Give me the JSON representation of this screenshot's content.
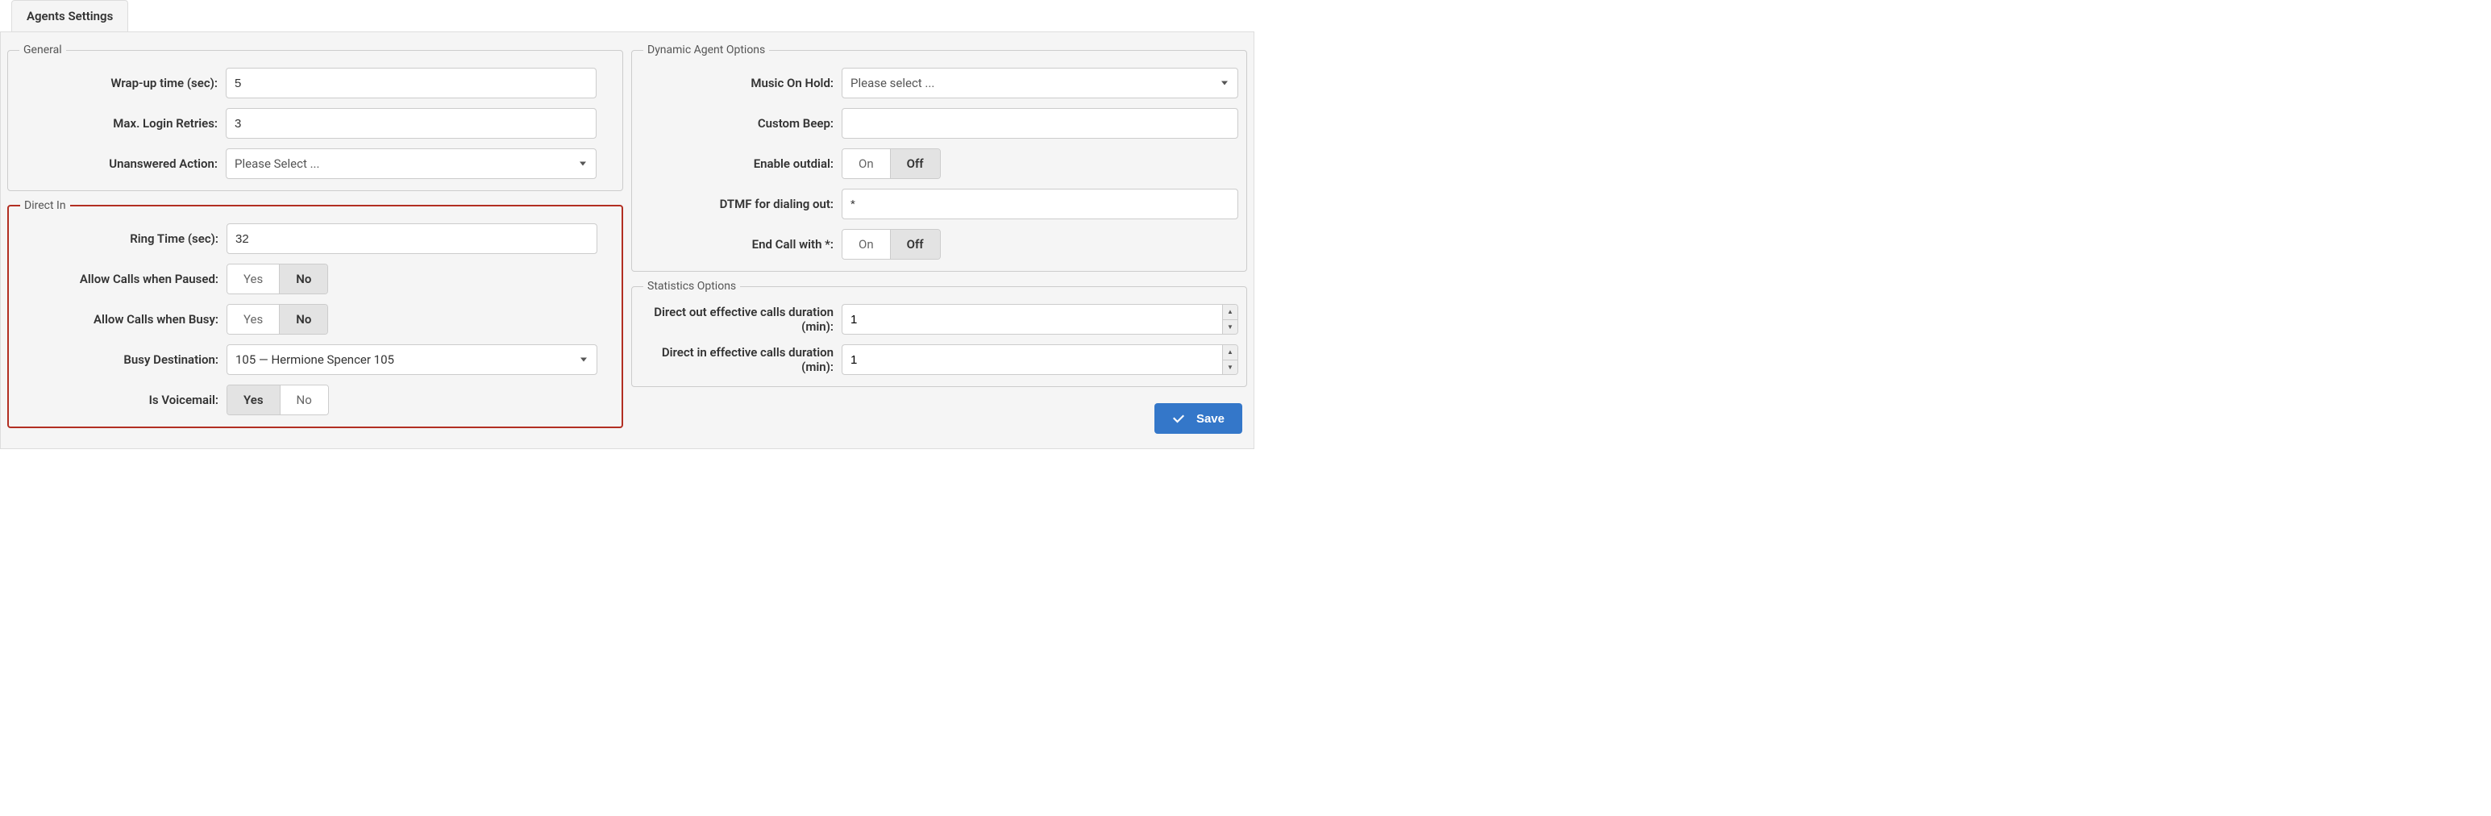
{
  "tab": "Agents Settings",
  "general": {
    "legend": "General",
    "wrapup_label": "Wrap-up time (sec):",
    "wrapup_value": "5",
    "retries_label": "Max. Login Retries:",
    "retries_value": "3",
    "unanswered_label": "Unanswered Action:",
    "unanswered_value": "Please Select ..."
  },
  "directin": {
    "legend": "Direct In",
    "ring_label": "Ring Time (sec):",
    "ring_value": "32",
    "paused_label": "Allow Calls when Paused:",
    "paused_yes": "Yes",
    "paused_no": "No",
    "busy_label": "Allow Calls when Busy:",
    "busy_yes": "Yes",
    "busy_no": "No",
    "busydest_label": "Busy Destination:",
    "busydest_value": "105  —  Hermione Spencer 105",
    "voicemail_label": "Is Voicemail:",
    "voicemail_yes": "Yes",
    "voicemail_no": "No"
  },
  "dynamic": {
    "legend": "Dynamic Agent Options",
    "moh_label": "Music On Hold:",
    "moh_value": "Please select ...",
    "beep_label": "Custom Beep:",
    "beep_value": "",
    "outdial_label": "Enable outdial:",
    "outdial_on": "On",
    "outdial_off": "Off",
    "dtmf_label": "DTMF for dialing out:",
    "dtmf_value": "*",
    "endcall_label": "End Call with *:",
    "endcall_on": "On",
    "endcall_off": "Off"
  },
  "stats": {
    "legend": "Statistics Options",
    "out_label": "Direct out effective calls duration (min):",
    "out_value": "1",
    "in_label": "Direct in effective calls duration (min):",
    "in_value": "1"
  },
  "save_label": "Save"
}
